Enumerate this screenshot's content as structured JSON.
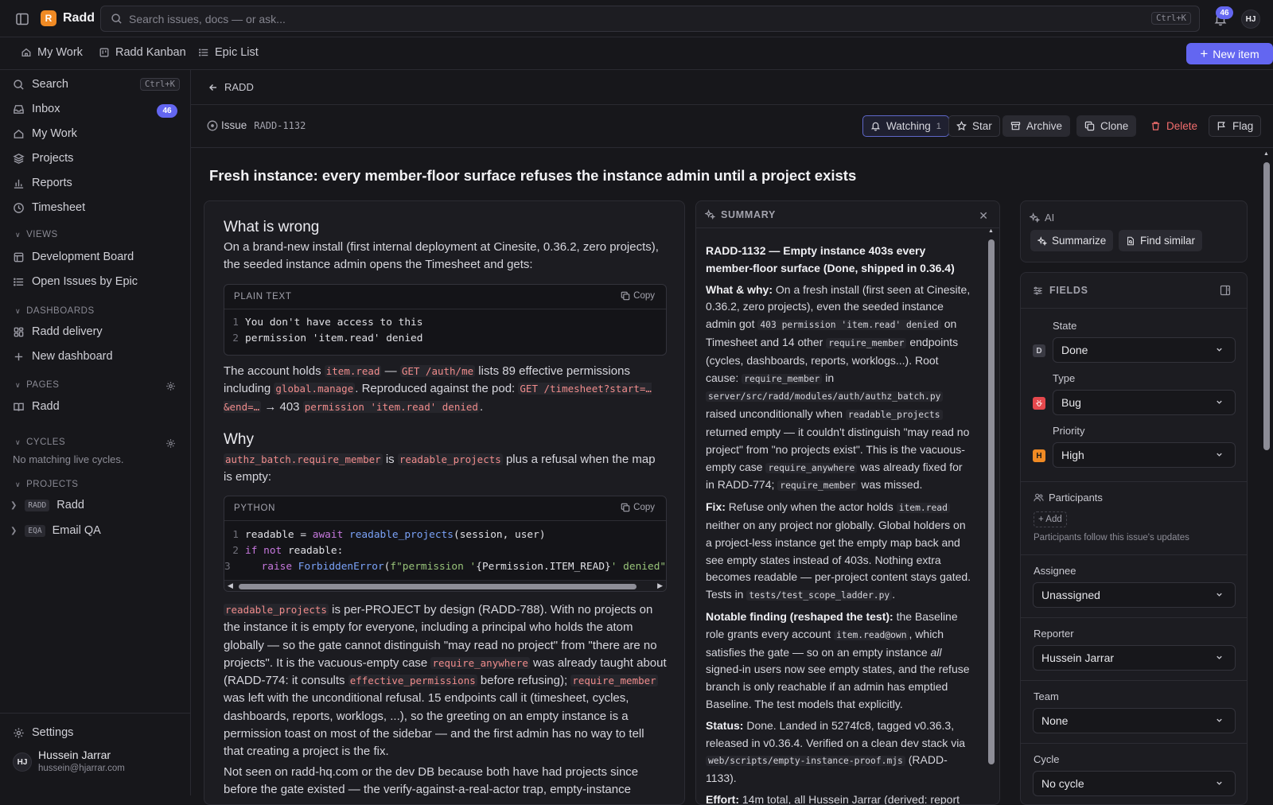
{
  "app": {
    "name": "Radd",
    "logo_glyph": "R"
  },
  "search": {
    "placeholder": "Search issues, docs — or ask...",
    "shortcut": "Ctrl+K"
  },
  "notifications": {
    "count": "46"
  },
  "user": {
    "initials": "HJ",
    "name": "Hussein Jarrar",
    "email": "hussein@hjarrar.com"
  },
  "tabs": [
    {
      "label": "My Work",
      "icon": "home-icon"
    },
    {
      "label": "Radd Kanban",
      "icon": "kanban-icon"
    },
    {
      "label": "Epic List",
      "icon": "list-icon"
    }
  ],
  "new_item_label": "New item",
  "sidebar": {
    "search": "Search",
    "search_shortcut": "Ctrl+K",
    "inbox": "Inbox",
    "inbox_count": "46",
    "my_work": "My Work",
    "projects": "Projects",
    "reports": "Reports",
    "timesheet": "Timesheet",
    "views_header": "VIEWS",
    "views": [
      "Development Board",
      "Open Issues by Epic"
    ],
    "dashboards_header": "DASHBOARDS",
    "dashboards": [
      "Radd delivery"
    ],
    "new_dashboard": "New dashboard",
    "pages_header": "PAGES",
    "pages": [
      "Radd"
    ],
    "cycles_header": "CYCLES",
    "cycles_empty": "No matching live cycles.",
    "projects_header": "PROJECTS",
    "project_list": [
      {
        "key": "RADD",
        "name": "Radd"
      },
      {
        "key": "EQA",
        "name": "Email QA"
      }
    ],
    "settings": "Settings"
  },
  "breadcrumb": "RADD",
  "issue": {
    "type_label": "Issue",
    "key": "RADD-1132",
    "title": "Fresh instance: every member-floor surface refuses the instance admin until a project exists"
  },
  "actions": {
    "watching": "Watching",
    "watch_count": "1",
    "star": "Star",
    "archive": "Archive",
    "clone": "Clone",
    "delete": "Delete",
    "flag": "Flag"
  },
  "description": {
    "h_wrong": "What is wrong",
    "p1": "On a brand-new install (first internal deployment at Cinesite, 0.36.2, zero projects), the seeded instance admin opens the Timesheet and gets:",
    "code1_lang": "PLAIN TEXT",
    "code1_lines": [
      "You don't have access to this",
      "permission 'item.read' denied"
    ],
    "copy": "Copy",
    "p2_a": "The account holds ",
    "p2_code1": "item.read",
    "p2_b": " — ",
    "p2_code2": "GET /auth/me",
    "p2_c": " lists 89 effective permissions including ",
    "p2_code3": "global.manage",
    "p2_d": ". Reproduced against the pod: ",
    "p2_code4": "GET /timesheet?start=…&end=…",
    "p2_e": " → 403 ",
    "p2_code5": "permission 'item.read' denied",
    "p2_f": ".",
    "h_why": "Why",
    "p3_code1": "authz_batch.require_member",
    "p3_a": " is ",
    "p3_code2": "readable_projects",
    "p3_b": " plus a refusal when the map is empty:",
    "code2_lang": "PYTHON",
    "p4_code1": "readable_projects",
    "p4_a": " is per-PROJECT by design (RADD-788). With no projects on the instance it is empty for everyone, including a principal who holds the atom globally — so the gate cannot distinguish \"may read no project\" from \"there are no projects\". It is the vacuous-empty case ",
    "p4_code2": "require_anywhere",
    "p4_b": " was already taught about (RADD-774: it consults ",
    "p4_code3": "effective_permissions",
    "p4_c": " before refusing); ",
    "p4_code4": "require_member",
    "p4_d": " was left with the unconditional refusal. 15 endpoints call it (timesheet, cycles, dashboards, reports, worklogs, ...), so the greeting on an empty instance is a permission toast on most of the sidebar — and the first admin has no way to tell that creating a project is the fix.",
    "p5": "Not seen on radd-hq.com or the dev DB because both have had projects since before the gate existed — the verify-against-a-real-actor trap, empty-instance"
  },
  "summary": {
    "header": "SUMMARY",
    "headline": "RADD-1132 — Empty instance 403s every member-floor surface (Done, shipped in 0.36.4)",
    "what_label": "What & why:",
    "what_a": " On a fresh install (first seen at Cinesite, 0.36.2, zero projects), even the seeded instance admin got ",
    "what_code1": "403 permission 'item.read' denied",
    "what_b": " on Timesheet and 14 other ",
    "what_code2": "require_member",
    "what_c": " endpoints (cycles, dashboards, reports, worklogs...). Root cause: ",
    "what_code3": "require_member",
    "what_d": " in ",
    "what_code4": "server/src/radd/modules/auth/authz_batch.py",
    "what_e": " raised unconditionally when ",
    "what_code5": "readable_projects",
    "what_f": " returned empty — it couldn't distinguish \"may read no project\" from \"no projects exist\". This is the vacuous-empty case ",
    "what_code6": "require_anywhere",
    "what_g": " was already fixed for in RADD-774; ",
    "what_code7": "require_member",
    "what_h": " was missed.",
    "fix_label": "Fix:",
    "fix_a": " Refuse only when the actor holds ",
    "fix_code1": "item.read",
    "fix_b": " neither on any project nor globally. Global holders on a project-less instance get the empty map back and see empty states instead of 403s. Nothing extra becomes readable — per-project content stays gated. Tests in ",
    "fix_code2": "tests/test_scope_ladder.py",
    "fix_c": ".",
    "note_label": "Notable finding (reshaped the test):",
    "note_a": " the Baseline role grants every account ",
    "note_code1": "item.read@own",
    "note_b": ", which satisfies the gate — so on an empty instance ",
    "note_em": "all",
    "note_c": " signed-in users now see empty states, and the refuse branch is only reachable if an admin has emptied Baseline. The test models that explicitly.",
    "status_label": "Status:",
    "status_a": " Done. Landed in 5274fc8, tagged v0.36.3, released in v0.36.4. Verified on a clean dev stack via ",
    "status_code1": "web/scripts/empty-instance-proof.mjs",
    "status_b": " (RADD-1133).",
    "effort_label": "Effort:",
    "effort_a": " 14m total, all Hussein Jarrar (derived: report"
  },
  "ai": {
    "header": "AI",
    "summarize": "Summarize",
    "find_similar": "Find similar"
  },
  "fields": {
    "header": "FIELDS",
    "state_label": "State",
    "state_value": "Done",
    "state_icon": "D",
    "type_label": "Type",
    "type_value": "Bug",
    "priority_label": "Priority",
    "priority_value": "High",
    "priority_icon": "H",
    "participants_label": "Participants",
    "add_label": "+ Add",
    "participants_hint": "Participants follow this issue's updates",
    "assignee_label": "Assignee",
    "assignee_value": "Unassigned",
    "reporter_label": "Reporter",
    "reporter_value": "Hussein Jarrar",
    "team_label": "Team",
    "team_value": "None",
    "cycle_label": "Cycle",
    "cycle_value": "No cycle"
  },
  "colors": {
    "accent": "#6366f1",
    "brand": "#f08a24",
    "danger": "#f26d6d",
    "bug": "#e5484d",
    "priority_high": "#f08a24"
  }
}
